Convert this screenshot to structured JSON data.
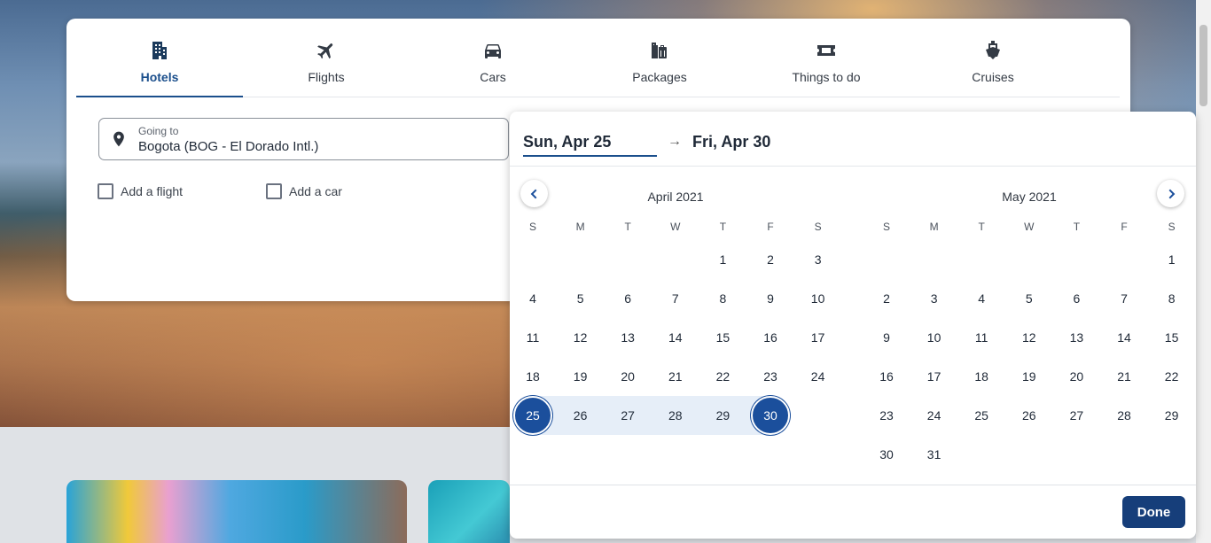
{
  "tabs": [
    {
      "label": "Hotels",
      "icon": "building-icon",
      "active": true
    },
    {
      "label": "Flights",
      "icon": "airplane-icon"
    },
    {
      "label": "Cars",
      "icon": "car-icon"
    },
    {
      "label": "Packages",
      "icon": "luggage-icon"
    },
    {
      "label": "Things to do",
      "icon": "ticket-icon"
    },
    {
      "label": "Cruises",
      "icon": "ship-icon"
    }
  ],
  "destination": {
    "label": "Going to",
    "value": "Bogota (BOG - El Dorado Intl.)",
    "icon": "map-pin-icon"
  },
  "options": {
    "add_flight": "Add a flight",
    "add_car": "Add a car"
  },
  "calendar": {
    "start_date": "Sun, Apr 25",
    "end_date": "Fri, Apr 30",
    "done_label": "Done",
    "weekdays": [
      "S",
      "M",
      "T",
      "W",
      "T",
      "F",
      "S"
    ],
    "months": [
      {
        "title": "April 2021",
        "first_weekday": 4,
        "days": 30,
        "selected_start": 25,
        "selected_end": 30
      },
      {
        "title": "May 2021",
        "first_weekday": 6,
        "days": 31
      }
    ]
  },
  "colors": {
    "accent": "#1b4f9c",
    "done_button": "#163e7a",
    "range": "#e6eef8"
  }
}
